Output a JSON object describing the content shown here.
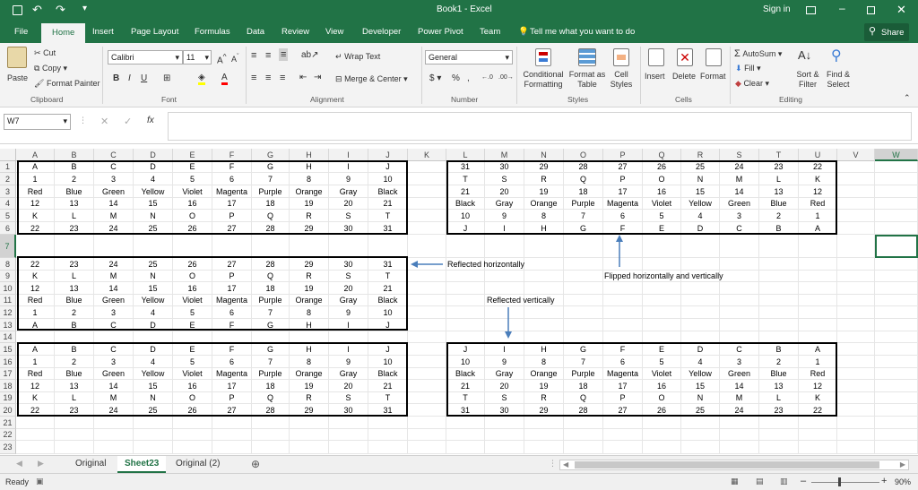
{
  "title_bar": {
    "document_title": "Book1 - Excel",
    "sign_in": "Sign in",
    "share": "Share"
  },
  "ribbon_tabs": [
    "File",
    "Home",
    "Insert",
    "Page Layout",
    "Formulas",
    "Data",
    "Review",
    "View",
    "Developer",
    "Power Pivot",
    "Team"
  ],
  "tell_me": "Tell me what you want to do",
  "ribbon": {
    "paste": "Paste",
    "cut": "Cut",
    "copy": "Copy",
    "format_painter": "Format Painter",
    "font_name": "Calibri",
    "font_size": "11",
    "wrap_text": "Wrap Text",
    "merge_center": "Merge & Center",
    "number_format": "General",
    "conditional_formatting": "Conditional Formatting",
    "format_as_table": "Format as Table",
    "cell_styles": "Cell Styles",
    "insert": "Insert",
    "delete": "Delete",
    "format": "Format",
    "autosum": "AutoSum",
    "fill": "Fill",
    "clear": "Clear",
    "sort_filter": "Sort & Filter",
    "find_select": "Find & Select",
    "groups": [
      "Clipboard",
      "Font",
      "Alignment",
      "Number",
      "Styles",
      "Cells",
      "Editing"
    ]
  },
  "name_box": "W7",
  "formula_value": "",
  "columns": [
    "A",
    "B",
    "C",
    "D",
    "E",
    "F",
    "G",
    "H",
    "I",
    "J",
    "K",
    "L",
    "M",
    "N",
    "O",
    "P",
    "Q",
    "R",
    "S",
    "T",
    "U",
    "V",
    "W"
  ],
  "rows": [
    "1",
    "2",
    "3",
    "4",
    "5",
    "6",
    "7",
    "8",
    "9",
    "10",
    "11",
    "12",
    "13",
    "14",
    "15",
    "16",
    "17",
    "18",
    "19",
    "20",
    "21",
    "22",
    "23"
  ],
  "blocks": {
    "original": [
      [
        "A",
        "B",
        "C",
        "D",
        "E",
        "F",
        "G",
        "H",
        "I",
        "J"
      ],
      [
        "1",
        "2",
        "3",
        "4",
        "5",
        "6",
        "7",
        "8",
        "9",
        "10"
      ],
      [
        "Red",
        "Blue",
        "Green",
        "Yellow",
        "Violet",
        "Magenta",
        "Purple",
        "Orange",
        "Gray",
        "Black"
      ],
      [
        "12",
        "13",
        "14",
        "15",
        "16",
        "17",
        "18",
        "19",
        "20",
        "21"
      ],
      [
        "K",
        "L",
        "M",
        "N",
        "O",
        "P",
        "Q",
        "R",
        "S",
        "T"
      ],
      [
        "22",
        "23",
        "24",
        "25",
        "26",
        "27",
        "28",
        "29",
        "30",
        "31"
      ]
    ],
    "flipped_both": [
      [
        "31",
        "30",
        "29",
        "28",
        "27",
        "26",
        "25",
        "24",
        "23",
        "22"
      ],
      [
        "T",
        "S",
        "R",
        "Q",
        "P",
        "O",
        "N",
        "M",
        "L",
        "K"
      ],
      [
        "21",
        "20",
        "19",
        "18",
        "17",
        "16",
        "15",
        "14",
        "13",
        "12"
      ],
      [
        "Black",
        "Gray",
        "Orange",
        "Purple",
        "Magenta",
        "Violet",
        "Yellow",
        "Green",
        "Blue",
        "Red"
      ],
      [
        "10",
        "9",
        "8",
        "7",
        "6",
        "5",
        "4",
        "3",
        "2",
        "1"
      ],
      [
        "J",
        "I",
        "H",
        "G",
        "F",
        "E",
        "D",
        "C",
        "B",
        "A"
      ]
    ],
    "reflected_horizontally": [
      [
        "22",
        "23",
        "24",
        "25",
        "26",
        "27",
        "28",
        "29",
        "30",
        "31"
      ],
      [
        "K",
        "L",
        "M",
        "N",
        "O",
        "P",
        "Q",
        "R",
        "S",
        "T"
      ],
      [
        "12",
        "13",
        "14",
        "15",
        "16",
        "17",
        "18",
        "19",
        "20",
        "21"
      ],
      [
        "Red",
        "Blue",
        "Green",
        "Yellow",
        "Violet",
        "Magenta",
        "Purple",
        "Orange",
        "Gray",
        "Black"
      ],
      [
        "1",
        "2",
        "3",
        "4",
        "5",
        "6",
        "7",
        "8",
        "9",
        "10"
      ],
      [
        "A",
        "B",
        "C",
        "D",
        "E",
        "F",
        "G",
        "H",
        "I",
        "J"
      ]
    ],
    "copy_original": [
      [
        "A",
        "B",
        "C",
        "D",
        "E",
        "F",
        "G",
        "H",
        "I",
        "J"
      ],
      [
        "1",
        "2",
        "3",
        "4",
        "5",
        "6",
        "7",
        "8",
        "9",
        "10"
      ],
      [
        "Red",
        "Blue",
        "Green",
        "Yellow",
        "Violet",
        "Magenta",
        "Purple",
        "Orange",
        "Gray",
        "Black"
      ],
      [
        "12",
        "13",
        "14",
        "15",
        "16",
        "17",
        "18",
        "19",
        "20",
        "21"
      ],
      [
        "K",
        "L",
        "M",
        "N",
        "O",
        "P",
        "Q",
        "R",
        "S",
        "T"
      ],
      [
        "22",
        "23",
        "24",
        "25",
        "26",
        "27",
        "28",
        "29",
        "30",
        "31"
      ]
    ],
    "reflected_vertically": [
      [
        "J",
        "I",
        "H",
        "G",
        "F",
        "E",
        "D",
        "C",
        "B",
        "A"
      ],
      [
        "10",
        "9",
        "8",
        "7",
        "6",
        "5",
        "4",
        "3",
        "2",
        "1"
      ],
      [
        "Black",
        "Gray",
        "Orange",
        "Purple",
        "Magenta",
        "Violet",
        "Yellow",
        "Green",
        "Blue",
        "Red"
      ],
      [
        "21",
        "20",
        "19",
        "18",
        "17",
        "16",
        "15",
        "14",
        "13",
        "12"
      ],
      [
        "T",
        "S",
        "R",
        "Q",
        "P",
        "O",
        "N",
        "M",
        "L",
        "K"
      ],
      [
        "31",
        "30",
        "29",
        "28",
        "27",
        "26",
        "25",
        "24",
        "23",
        "22"
      ]
    ]
  },
  "annotations": {
    "reflected_horizontally": "Reflected horizontally",
    "flipped": "Flipped horizontally and vertically",
    "reflected_vertically": "Reflected vertically"
  },
  "sheet_tabs": [
    "Original",
    "Sheet23",
    "Original (2)"
  ],
  "active_sheet": "Sheet23",
  "status": {
    "ready": "Ready",
    "zoom": "90%"
  },
  "colors": {
    "excel_green": "#217346",
    "arrow_blue": "#4a7ebb"
  }
}
